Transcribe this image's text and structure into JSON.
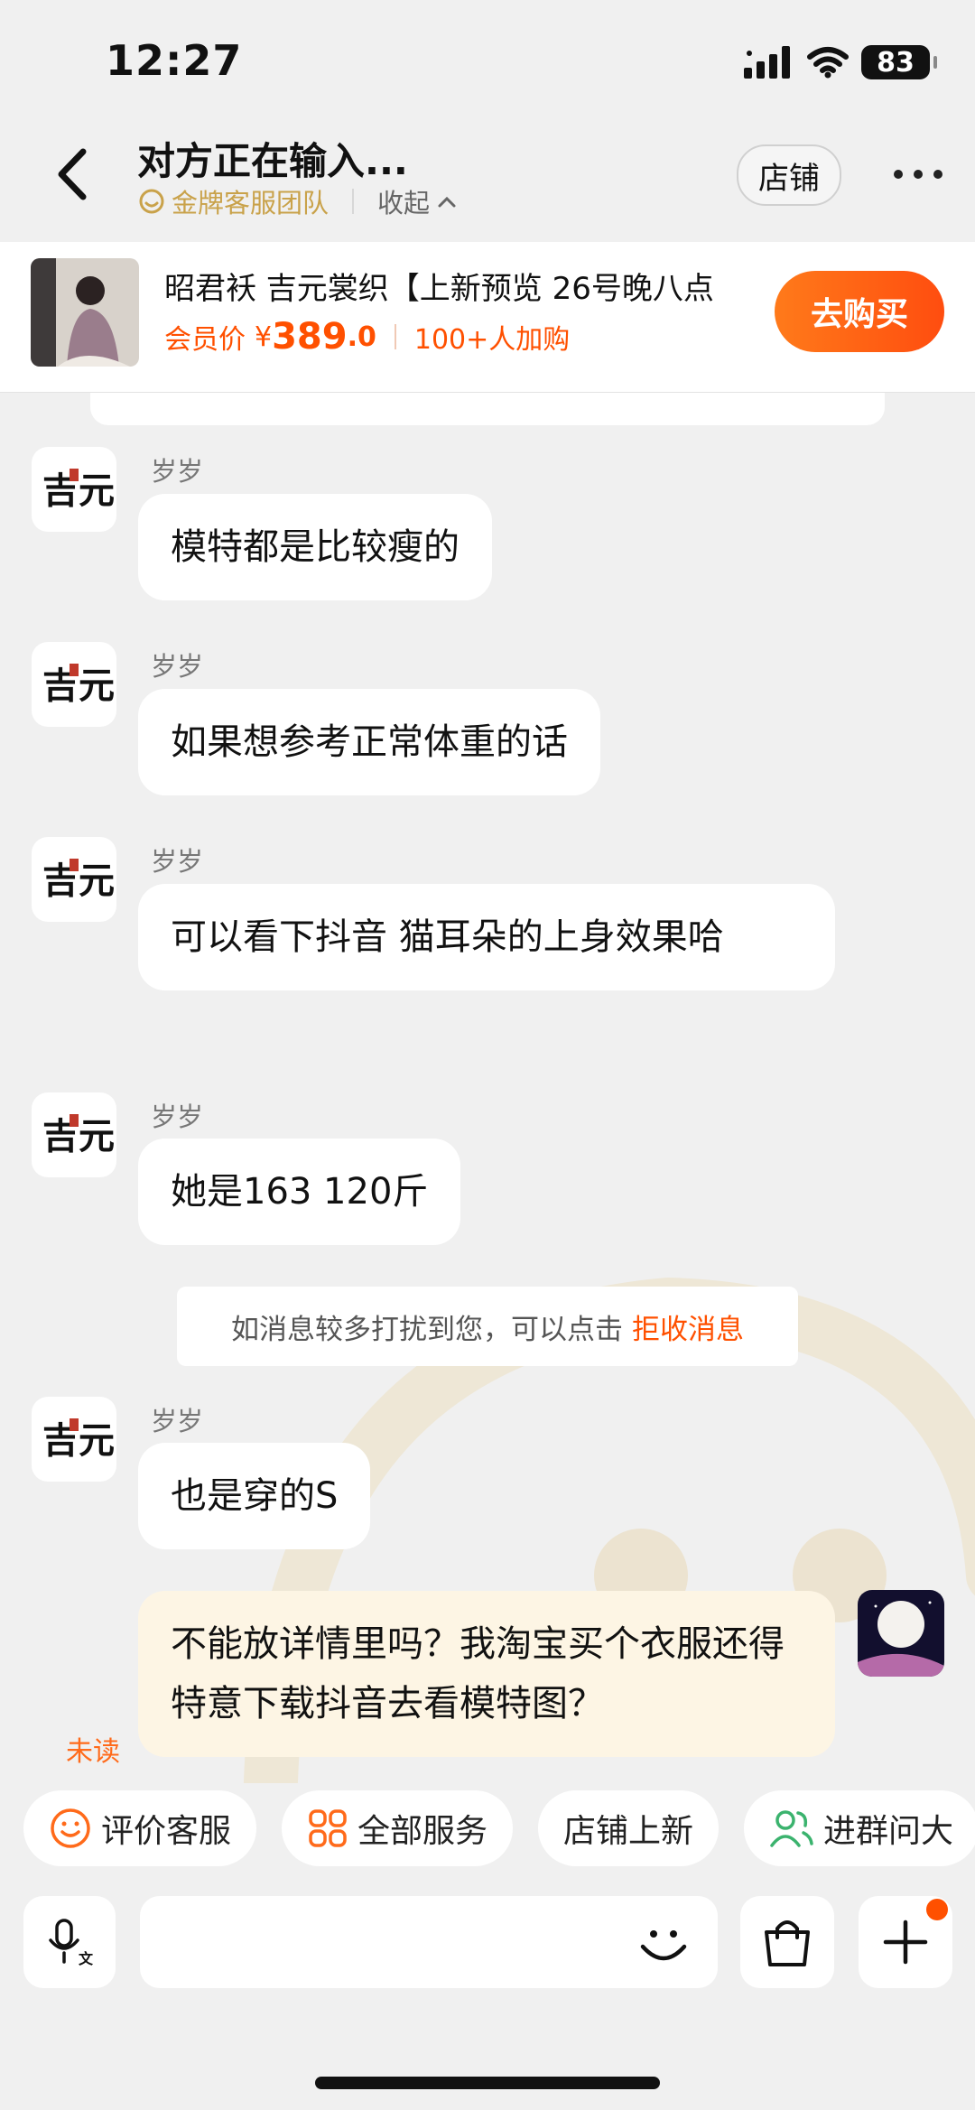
{
  "status_bar": {
    "time": "12:27",
    "battery": "83",
    "icons": [
      "cellular-signal-icon",
      "wifi-icon",
      "battery-icon"
    ]
  },
  "header": {
    "title": "对方正在输入...",
    "team": "金牌客服团队",
    "collapse": "收起",
    "store_button": "店铺",
    "icons": [
      "back-arrow-icon",
      "more-dots-icon",
      "chevron-up-icon"
    ]
  },
  "product": {
    "title": "昭君袄 吉元裳织【上新预览 26号晚八点",
    "member_label": "会员价",
    "currency": "¥",
    "price_int": "389",
    "price_dec": ".0",
    "buyers": "100+人加购",
    "buy_button": "去购买"
  },
  "messages": [
    {
      "sender": "岁岁",
      "text": "模特都是比较瘦的"
    },
    {
      "sender": "岁岁",
      "text": "如果想参考正常体重的话"
    },
    {
      "sender": "岁岁",
      "text": "可以看下抖音 猫耳朵的上身效果哈"
    },
    {
      "sender": "岁岁",
      "text": "她是163 120斤"
    },
    {
      "sender": "岁岁",
      "text": "也是穿的S"
    }
  ],
  "notice": {
    "text": "如消息较多打扰到您，可以点击",
    "link": "拒收消息"
  },
  "my_message": {
    "text": "不能放详情里吗？我淘宝买个衣服还得特意下载抖音去看模特图？",
    "status": "未读"
  },
  "quick_actions": [
    "评价客服",
    "全部服务",
    "店铺上新",
    "进群问大"
  ],
  "input": {
    "placeholder": ""
  },
  "colors": {
    "accent": "#ff5000",
    "gold": "#c9a24a",
    "my_bubble": "#fdf5e4"
  }
}
